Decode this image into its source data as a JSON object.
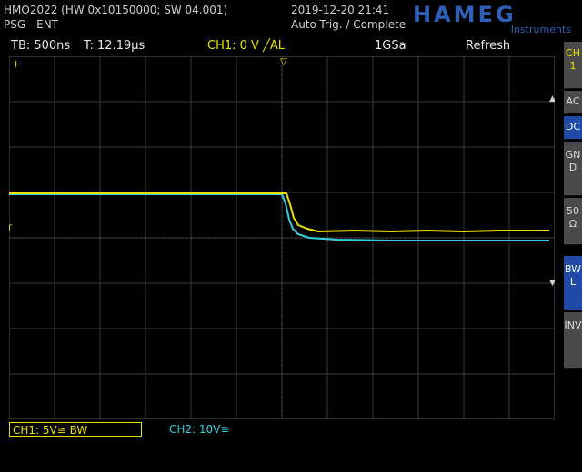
{
  "header": {
    "model": "HMO2022 (HW 0x10150000; SW 04.001)",
    "module": "PSG - ENT",
    "datetime": "2019-12-20 21:41",
    "trigger_state": "Auto-Trig. / Complete",
    "brand": "HAMEG",
    "brand_sub": "Instruments"
  },
  "status": {
    "timebase": "TB: 500ns",
    "trig_time": "T: 12.19µs",
    "trigger": "CH1: 0 V ╱AL",
    "sample_rate": "1GSa",
    "mode": "Refresh"
  },
  "side": {
    "channel": "CH 1",
    "ac": "AC",
    "dc": "DC",
    "gnd": "GND",
    "ohm": "50 Ω",
    "bwl": "BWL",
    "inv": "INV"
  },
  "footer": {
    "ch1": "CH1: 5V≅ BW",
    "ch2": "CH2: 10V≅"
  },
  "colors": {
    "ch1": "#e8e000",
    "ch2": "#30d0e0",
    "accent": "#1f4aa8"
  }
}
